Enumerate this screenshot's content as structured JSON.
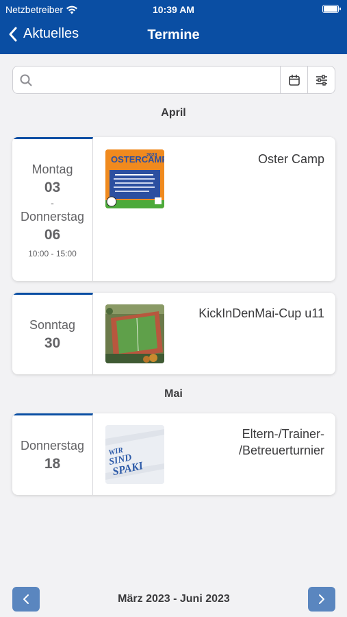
{
  "status": {
    "carrier": "Netzbetreiber",
    "time": "10:39 AM"
  },
  "nav": {
    "back_label": "Aktuelles",
    "title": "Termine"
  },
  "search": {
    "placeholder": ""
  },
  "sections": [
    {
      "month": "April",
      "events": [
        {
          "weekday_start": "Montag",
          "day_start": "03",
          "dash": "-",
          "weekday_end": "Donnerstag",
          "day_end": "06",
          "time": "10:00 - 15:00",
          "title": "Oster Camp",
          "thumb_text": {
            "top": "OSTERCAMP",
            "year": "2023"
          }
        },
        {
          "weekday": "Sonntag",
          "day": "30",
          "title": "KickInDenMai-Cup u11"
        }
      ]
    },
    {
      "month": "Mai",
      "events": [
        {
          "weekday": "Donnerstag",
          "day": "18",
          "title_line1": "Eltern-/Trainer-",
          "title_line2": "/Betreuerturnier",
          "thumb_text": {
            "line1": "WIR",
            "line2": "SIND",
            "line3": "SPAKI"
          }
        }
      ]
    }
  ],
  "footer": {
    "range": "März 2023 - Juni 2023"
  },
  "colors": {
    "header": "#0a4ea3",
    "accent": "#0a4ea3",
    "page_button": "#5a86bf"
  }
}
